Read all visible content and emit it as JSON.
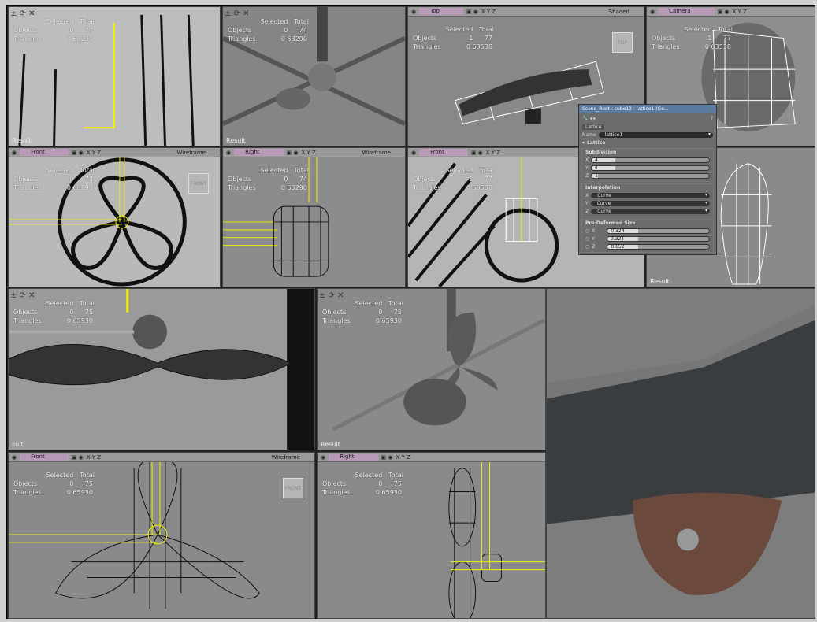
{
  "stats_labels": {
    "selected": "Selected",
    "total": "Total",
    "objects": "Objects",
    "triangles": "Triangles"
  },
  "viewports": [
    {
      "id": "vp1",
      "view": "",
      "mode": "",
      "objects": [
        "0",
        "74"
      ],
      "triangles": [
        "0",
        "63290"
      ],
      "result": "Result",
      "badge": ""
    },
    {
      "id": "vp2",
      "view": "",
      "mode": "",
      "objects": [
        "0",
        "74"
      ],
      "triangles": [
        "0",
        "63290"
      ],
      "result": "Result",
      "badge": ""
    },
    {
      "id": "vp3",
      "view": "Top",
      "mode": "Shaded",
      "objects": [
        "1",
        "77"
      ],
      "triangles": [
        "0",
        "63538"
      ],
      "result": "",
      "badge": "TOP"
    },
    {
      "id": "vp4",
      "view": "Camera",
      "mode": "",
      "objects": [
        "1",
        "77"
      ],
      "triangles": [
        "0",
        "63538"
      ],
      "result": "",
      "badge": ""
    },
    {
      "id": "vp5",
      "view": "Front",
      "mode": "Wireframe",
      "objects": [
        "0",
        "74"
      ],
      "triangles": [
        "0",
        "63290"
      ],
      "result": "",
      "badge": "FRONT"
    },
    {
      "id": "vp6",
      "view": "Right",
      "mode": "Wireframe",
      "objects": [
        "0",
        "74"
      ],
      "triangles": [
        "0",
        "63290"
      ],
      "result": "",
      "badge": ""
    },
    {
      "id": "vp7",
      "view": "Front",
      "mode": "",
      "objects": [
        "1",
        "77"
      ],
      "triangles": [
        "0",
        "63538"
      ],
      "result": "",
      "badge": ""
    },
    {
      "id": "vp8",
      "view": "",
      "mode": "",
      "objects": null,
      "triangles": null,
      "result": "Result",
      "badge": ""
    },
    {
      "id": "vp9",
      "view": "",
      "mode": "",
      "objects": [
        "0",
        "75"
      ],
      "triangles": [
        "0",
        "65930"
      ],
      "result": "sult",
      "badge": ""
    },
    {
      "id": "vp10",
      "view": "",
      "mode": "",
      "objects": [
        "0",
        "75"
      ],
      "triangles": [
        "0",
        "65930"
      ],
      "result": "Result",
      "badge": ""
    },
    {
      "id": "vp11",
      "view": "",
      "mode": "",
      "objects": null,
      "triangles": null,
      "result": "",
      "badge": ""
    },
    {
      "id": "vp12",
      "view": "Front",
      "mode": "Wireframe",
      "objects": [
        "0",
        "75"
      ],
      "triangles": [
        "0",
        "65930"
      ],
      "result": "",
      "badge": "FRONT"
    },
    {
      "id": "vp13",
      "view": "Right",
      "mode": "",
      "objects": [
        "0",
        "75"
      ],
      "triangles": [
        "0",
        "65930"
      ],
      "result": "",
      "badge": ""
    }
  ],
  "axes": "X Y Z",
  "lattice": {
    "title": "Scene_Root : cube13 : lattice1 (Ge...",
    "tab": "Lattice",
    "name_label": "Name",
    "name_value": "lattice1",
    "section": "Lattice",
    "subdivision": {
      "label": "Subdivision",
      "x": "4",
      "y": "4",
      "z": "1"
    },
    "interpolation": {
      "label": "Interpolation",
      "x": "Curve",
      "y": "Curve",
      "z": "Curve"
    },
    "predeformed": {
      "label": "Pre-Deformed Size",
      "x": "0.324",
      "y": "0.324",
      "z": "0.652"
    },
    "axis_labels": {
      "x": "X",
      "y": "Y",
      "z": "Z"
    }
  }
}
